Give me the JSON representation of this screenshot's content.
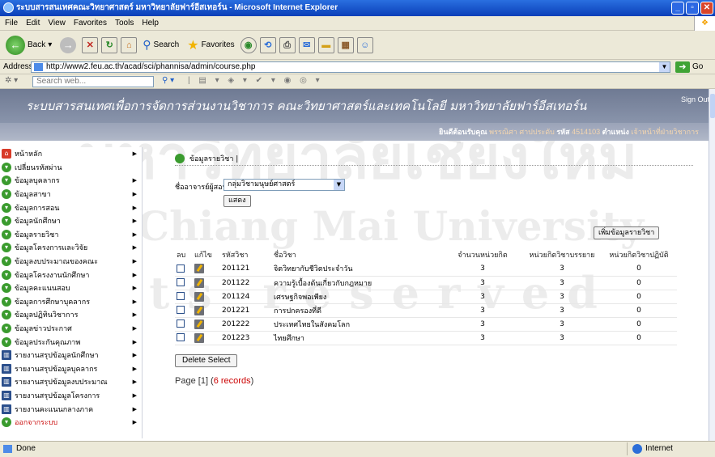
{
  "window": {
    "title": "ระบบสารสนเทศคณะวิทยาศาสตร์ มหาวิทยาลัยฟาร์อีสเทอร์น - Microsoft Internet Explorer"
  },
  "menu": [
    "File",
    "Edit",
    "View",
    "Favorites",
    "Tools",
    "Help"
  ],
  "toolbar": {
    "back": "Back",
    "search": "Search",
    "favorites": "Favorites"
  },
  "address": {
    "label": "Address",
    "url": "http://www2.feu.ac.th/acad/sci/phannisa/admin/course.php",
    "go": "Go"
  },
  "searchbar": {
    "placeholder": "Search web..."
  },
  "banner": {
    "title": "ระบบสารสนเทศเพื่อการจัดการส่วนงานวิชาการ คณะวิทยาศาสตร์และเทคโนโลยี มหาวิทยาลัยฟาร์อีสเทอร์น",
    "sign_out": "Sign Out"
  },
  "welcome": {
    "greeting": "ยินดีต้อนรับคุณ",
    "user": "พรรณิศา ศาปประดับ",
    "id_label": "รหัส",
    "id": "4514103",
    "position_label": "ตำแหน่ง",
    "position": "เจ้าหน้าที่ฝ่ายวิชาการ"
  },
  "sidebar": {
    "items": [
      {
        "label": "หน้าหลัก",
        "icon": "home-icon",
        "arrow": true
      },
      {
        "label": "เปลี่ยนรหัสผ่าน",
        "icon": "bullet-icon",
        "arrow": false
      },
      {
        "label": "ข้อมูลบุคลากร",
        "icon": "bullet-icon",
        "arrow": true
      },
      {
        "label": "ข้อมูลสาขา",
        "icon": "bullet-icon",
        "arrow": true
      },
      {
        "label": "ข้อมูลการสอน",
        "icon": "bullet-icon",
        "arrow": true
      },
      {
        "label": "ข้อมูลนักศึกษา",
        "icon": "bullet-icon",
        "arrow": true
      },
      {
        "label": "ข้อมูลรายวิชา",
        "icon": "bullet-icon",
        "arrow": true
      },
      {
        "label": "ข้อมูลโครงการและวิจัย",
        "icon": "bullet-icon",
        "arrow": true
      },
      {
        "label": "ข้อมูลงบประมาณของคณะ",
        "icon": "bullet-icon",
        "arrow": true
      },
      {
        "label": "ข้อมูลโครงงานนักศึกษา",
        "icon": "bullet-icon",
        "arrow": true
      },
      {
        "label": "ข้อมูลคะแนนสอบ",
        "icon": "bullet-icon",
        "arrow": true
      },
      {
        "label": "ข้อมูลการศึกษาบุคลากร",
        "icon": "bullet-icon",
        "arrow": true
      },
      {
        "label": "ข้อมูลปฏิทินวิชาการ",
        "icon": "bullet-icon",
        "arrow": true
      },
      {
        "label": "ข้อมูลข่าวประกาศ",
        "icon": "bullet-icon",
        "arrow": true
      },
      {
        "label": "ข้อมูลประกันคุณภาพ",
        "icon": "bullet-icon",
        "arrow": true
      },
      {
        "label": "รายงานสรุปข้อมูลนักศึกษา",
        "icon": "book-icon",
        "arrow": true
      },
      {
        "label": "รายงานสรุปข้อมูลบุคลากร",
        "icon": "book-icon",
        "arrow": true
      },
      {
        "label": "รายงานสรุปข้อมูลงบประมาณ",
        "icon": "book-icon",
        "arrow": true
      },
      {
        "label": "รายงานสรุปข้อมูลโครงการ",
        "icon": "book-icon",
        "arrow": true
      },
      {
        "label": "รายงานคะแนนกลางภาค",
        "icon": "book-icon",
        "arrow": true
      },
      {
        "label": "ออกจากระบบ",
        "icon": "logout-icon",
        "arrow": true
      }
    ]
  },
  "main": {
    "header": "ข้อมูลรายวิชา |",
    "teacher_label": "ชื่ออาจารย์ผู้สอน:",
    "teacher_select": "กลุ่มวิชามนุษย์ศาสตร์",
    "show_button": "แสดง",
    "add_button": "เพิ่มข้อมูลรายวิชา",
    "columns": [
      "ลบ",
      "แก้ไข",
      "รหัสวิชา",
      "ชื่อวิชา",
      "จำนวนหน่วยกิต",
      "หน่วยกิตวิชาบรรยาย",
      "หน่วยกิตวิชาปฏิบัติ"
    ],
    "rows": [
      {
        "code": "201121",
        "name": "จิตวิทยากับชีวิตประจำวัน",
        "credits": "3",
        "lecture": "3",
        "practice": "0"
      },
      {
        "code": "201122",
        "name": "ความรู้เบื้องต้นเกี่ยวกับกฎหมาย",
        "credits": "3",
        "lecture": "3",
        "practice": "0"
      },
      {
        "code": "201124",
        "name": "เศรษฐกิจพอเพียง",
        "credits": "3",
        "lecture": "3",
        "practice": "0"
      },
      {
        "code": "201221",
        "name": "การปกครองที่ดี",
        "credits": "3",
        "lecture": "3",
        "practice": "0"
      },
      {
        "code": "201222",
        "name": "ประเทศไทยในสังคมโลก",
        "credits": "3",
        "lecture": "3",
        "practice": "0"
      },
      {
        "code": "201223",
        "name": "ไทยศึกษา",
        "credits": "3",
        "lecture": "3",
        "practice": "0"
      }
    ],
    "delete_button": "Delete Select",
    "pager_prefix": "Page [",
    "pager_page": "1",
    "pager_mid": "] (",
    "pager_count": "6 records",
    "pager_suffix": ")"
  },
  "watermark": {
    "line1": "มหาวิทยาลัยเชียงใหม่",
    "line2": "by Chiang Mai University",
    "line3": "hts reserved"
  },
  "statusbar": {
    "left": "Done",
    "zone": "Internet"
  }
}
